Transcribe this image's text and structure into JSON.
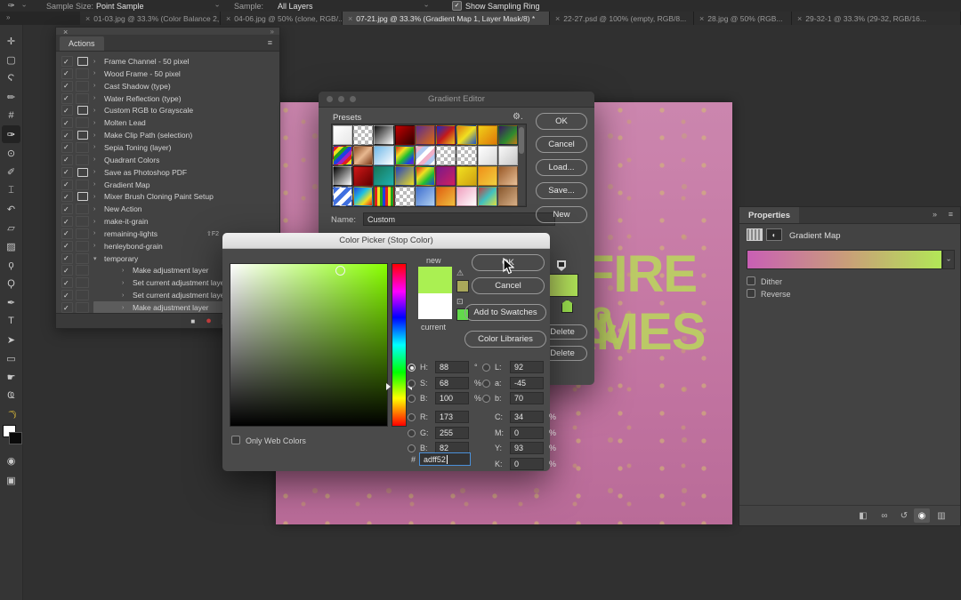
{
  "options_bar": {
    "tool_glyph": "✑",
    "sample_size_label": "Sample Size:",
    "sample_size_value": "Point Sample",
    "sample_label": "Sample:",
    "sample_value": "All Layers",
    "sampling_ring_label": "Show Sampling Ring",
    "sampling_ring_checked": true
  },
  "tabs": [
    {
      "label": "01-03.jpg @ 33.3% (Color Balance 2, Layer Mas...",
      "active": false
    },
    {
      "label": "04-06.jpg @ 50% (clone, RGB/...",
      "active": false
    },
    {
      "label": "07-21.jpg @ 33.3% (Gradient Map 1, Layer Mask/8) *",
      "active": true
    },
    {
      "label": "22-27.psd @ 100% (empty, RGB/8...",
      "active": false
    },
    {
      "label": "28.jpg @ 50% (RGB...",
      "active": false
    },
    {
      "label": "29-32-1 @ 33.3% (29-32, RGB/16...",
      "active": false
    }
  ],
  "toolbar": {
    "tools": [
      {
        "name": "move-tool",
        "glyph": "✛"
      },
      {
        "name": "marquee-tool",
        "glyph": "▢"
      },
      {
        "name": "lasso-tool",
        "glyph": "Ϛ"
      },
      {
        "name": "quick-selection-tool",
        "glyph": "✏"
      },
      {
        "name": "crop-tool",
        "glyph": "#"
      },
      {
        "name": "eyedropper-tool",
        "glyph": "✑",
        "selected": true
      },
      {
        "name": "healing-brush-tool",
        "glyph": "⊙"
      },
      {
        "name": "brush-tool",
        "glyph": "✐"
      },
      {
        "name": "clone-stamp-tool",
        "glyph": "⌶"
      },
      {
        "name": "history-brush-tool",
        "glyph": "↶"
      },
      {
        "name": "eraser-tool",
        "glyph": "▱"
      },
      {
        "name": "gradient-tool",
        "glyph": "▨"
      },
      {
        "name": "blur-tool",
        "glyph": "ϙ"
      },
      {
        "name": "dodge-tool",
        "glyph": "Ϙ"
      },
      {
        "name": "pen-tool",
        "glyph": "✒"
      },
      {
        "name": "type-tool",
        "glyph": "T"
      },
      {
        "name": "path-selection-tool",
        "glyph": "➤"
      },
      {
        "name": "shape-tool",
        "glyph": "▭"
      },
      {
        "name": "hand-tool",
        "glyph": "☛"
      },
      {
        "name": "zoom-tool",
        "glyph": "Ҩ"
      },
      {
        "name": "rotate-view-tool",
        "glyph": "☾",
        "banana": true
      }
    ],
    "quick_mask_glyph": "◉",
    "screen_mode_glyph": "▣"
  },
  "actions_panel": {
    "close_glyph": "×",
    "collapse_glyph": "»",
    "tab_label": "Actions",
    "menu_glyph": "≡",
    "items": [
      {
        "label": "Frame Channel - 50 pixel",
        "dialog": true
      },
      {
        "label": "Wood Frame - 50 pixel"
      },
      {
        "label": "Cast Shadow (type)"
      },
      {
        "label": "Water Reflection (type)"
      },
      {
        "label": "Custom RGB to Grayscale",
        "dialog": true
      },
      {
        "label": "Molten Lead"
      },
      {
        "label": "Make Clip Path (selection)",
        "dialog": true
      },
      {
        "label": "Sepia Toning (layer)"
      },
      {
        "label": "Quadrant Colors"
      },
      {
        "label": "Save as Photoshop PDF",
        "dialog": true
      },
      {
        "label": "Gradient Map"
      },
      {
        "label": "Mixer Brush Cloning Paint Setup",
        "dialog": true
      },
      {
        "label": "New Action"
      },
      {
        "label": "make-it-grain"
      },
      {
        "label": "remaining-lights",
        "shortcut": "⇧F2"
      },
      {
        "label": "henleybond-grain"
      },
      {
        "label": "temporary",
        "expanded": true
      },
      {
        "label": "Make adjustment layer",
        "indent": 1
      },
      {
        "label": "Set current adjustment layer",
        "indent": 1
      },
      {
        "label": "Set current adjustment layer",
        "indent": 1
      },
      {
        "label": "Make adjustment layer",
        "indent": 1,
        "selected": true
      }
    ],
    "transport": {
      "stop": "■",
      "record": "●",
      "play": "▶"
    }
  },
  "canvas": {
    "line1": "FIRE &",
    "line2": "FLAMES",
    "base_color": "#c678a4",
    "text_color": "rgba(187,208,97,0.92)"
  },
  "gradient_editor": {
    "title": "Gradient Editor",
    "presets_label": "Presets",
    "gear_glyph": "⚙.",
    "name_label": "Name:",
    "name_value": "Custom",
    "buttons": [
      "OK",
      "Cancel",
      "Load...",
      "Save...",
      "New"
    ],
    "delete_label": "Delete",
    "gradient_css": "linear-gradient(90deg,#c85fb5 0%,#c99f78 55%,#aee356 100%)",
    "presets": [
      "linear-gradient(135deg,#ffffff,#e6e6e6)",
      "checker",
      "linear-gradient(135deg,#101010,#ffffff)",
      "linear-gradient(135deg,#c00000,#320000)",
      "linear-gradient(135deg,#5a2d8e,#e06c10)",
      "linear-gradient(135deg,#1630c2,#c41a1a 50%,#e8c71c)",
      "linear-gradient(135deg,#e07b10,#f0e020 50%,#1a50c8)",
      "linear-gradient(135deg,#f0d018,#e07808)",
      "linear-gradient(135deg,#3a1560,#2e8b2e 60%,#c87818)",
      "repeating-linear-gradient(135deg,#e02020 0 4px,#f0e020 4px 8px,#20a020 8px 12px,#2040e0 12px 16px,#a020c0 16px 20px)",
      "linear-gradient(135deg,#8a4a20,#e8b890 50%,#7a3a18)",
      "linear-gradient(135deg,#70b8e8,#ffffff)",
      "linear-gradient(135deg,#e02020,#f0e020 30%,#20c030 55%,#2040e0 80%,#8020c0)",
      "repeating-linear-gradient(135deg,#f0b0c8 0 5px,#b0c8f0 5px 10px,#ffffff 10px 15px)",
      "checker",
      "checker",
      "linear-gradient(135deg,#ffffff,#d8d8d8)",
      "linear-gradient(135deg,#f8f8f8,#c8c8c8)",
      "linear-gradient(135deg,#000000,#ffffff)",
      "linear-gradient(135deg,#d01818,#600000)",
      "linear-gradient(135deg,#187858,#20b0b0)",
      "linear-gradient(135deg,#2040c0,#f0e020)",
      "linear-gradient(135deg,#e02020,#f0e020 35%,#20c030 65%,#2040e0)",
      "linear-gradient(135deg,#7a1a8a,#d02060)",
      "linear-gradient(135deg,#f0e020,#d0a010)",
      "linear-gradient(135deg,#f09018,#f0d040)",
      "linear-gradient(135deg,#9a5a28,#e8c098)",
      "repeating-linear-gradient(135deg,#4070e0 0 5px,#ffffff 5px 10px)",
      "linear-gradient(135deg,#2040e0,#20c0e0 40%,#f0e020 70%,#e02020)",
      "repeating-linear-gradient(90deg,#e02020 0 3px,#f0e020 3px 6px,#20a020 6px 9px,#2040e0 9px 12px)",
      "checker",
      "linear-gradient(135deg,#4070d0,#b0d0f0)",
      "linear-gradient(135deg,#e06010,#f0c040)",
      "linear-gradient(135deg,#f0a0c0,#ffffff)",
      "linear-gradient(135deg,#c04040,#40c0c0 50%,#e0e040)",
      "linear-gradient(135deg,#8a5a30,#d8b088)"
    ]
  },
  "color_picker": {
    "title": "Color Picker (Stop Color)",
    "new_label": "new",
    "current_label": "current",
    "new_color": "#aaf052",
    "current_color": "#ffffff",
    "gamut_warning_glyph": "⚠",
    "gamut_swatch_color": "#a9a85a",
    "web_warning_glyph": "⊡",
    "web_swatch_color": "#62d94b",
    "buttons": [
      "OK",
      "Cancel",
      "Add to Swatches",
      "Color Libraries"
    ],
    "hue_deg": 88,
    "left_fields": [
      {
        "label": "H:",
        "value": "88",
        "unit": "°",
        "radio": true,
        "selected": true
      },
      {
        "label": "S:",
        "value": "68",
        "unit": "%",
        "radio": true
      },
      {
        "label": "B:",
        "value": "100",
        "unit": "%",
        "radio": true
      },
      {
        "label": "R:",
        "value": "173",
        "radio": true,
        "gap": true
      },
      {
        "label": "G:",
        "value": "255",
        "radio": true
      },
      {
        "label": "B:",
        "value": "82",
        "radio": true
      }
    ],
    "right_fields": [
      {
        "label": "L:",
        "value": "92",
        "radio": true
      },
      {
        "label": "a:",
        "value": "-45",
        "radio": true
      },
      {
        "label": "b:",
        "value": "70",
        "radio": true
      },
      {
        "label": "C:",
        "value": "34",
        "unit": "%",
        "gap": true
      },
      {
        "label": "M:",
        "value": "0",
        "unit": "%"
      },
      {
        "label": "Y:",
        "value": "93",
        "unit": "%"
      },
      {
        "label": "K:",
        "value": "0",
        "unit": "%"
      }
    ],
    "hex_prefix": "#",
    "hex_value": "adff52",
    "only_web_label": "Only Web Colors"
  },
  "properties_panel": {
    "tab_label": "Properties",
    "collapse_glyph": "»",
    "menu_glyph": "≡",
    "adjustment_label": "Gradient Map",
    "gradient_css": "linear-gradient(90deg,#c95fb5 0%,#c99f78 52%,#b2e757 100%)",
    "dither_label": "Dither",
    "reverse_label": "Reverse",
    "bottom_icons": [
      {
        "name": "clip-to-layer-icon",
        "glyph": "◧"
      },
      {
        "name": "previous-state-icon",
        "glyph": "∞"
      },
      {
        "name": "reset-icon",
        "glyph": "↺"
      },
      {
        "name": "visibility-icon",
        "glyph": "◉",
        "active": true
      },
      {
        "name": "delete-icon",
        "glyph": "▥"
      }
    ]
  }
}
